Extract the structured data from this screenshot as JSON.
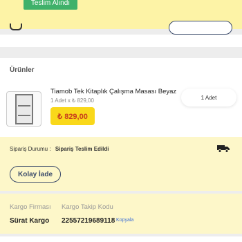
{
  "header": {
    "status_pill": "Teslim Alındı"
  },
  "products_section": {
    "title": "Ürünler",
    "items": [
      {
        "name": "Tiamob Tek Kitaplık Çalışma Masası Beyaz",
        "qty_price": "1 Adet x ₺ 829,00",
        "price": "₺ 829,00",
        "qty_label": "1 Adet"
      }
    ]
  },
  "order_status": {
    "label": "Sipariş Durumu :",
    "value": "Sipariş Teslim Edildi",
    "return_button": "Kolay İade"
  },
  "cargo": {
    "company_label": "Kargo Firması",
    "tracking_label": "Kargo Takip Kodu",
    "company": "Sürat Kargo",
    "tracking_code": "22557219689118",
    "copy_label": "Kopyala"
  },
  "colors": {
    "accent_yellow": "#f9d81a",
    "price_red": "#c83a1c",
    "status_green": "#3fb16a",
    "outline_navy": "#3a4a6a"
  }
}
